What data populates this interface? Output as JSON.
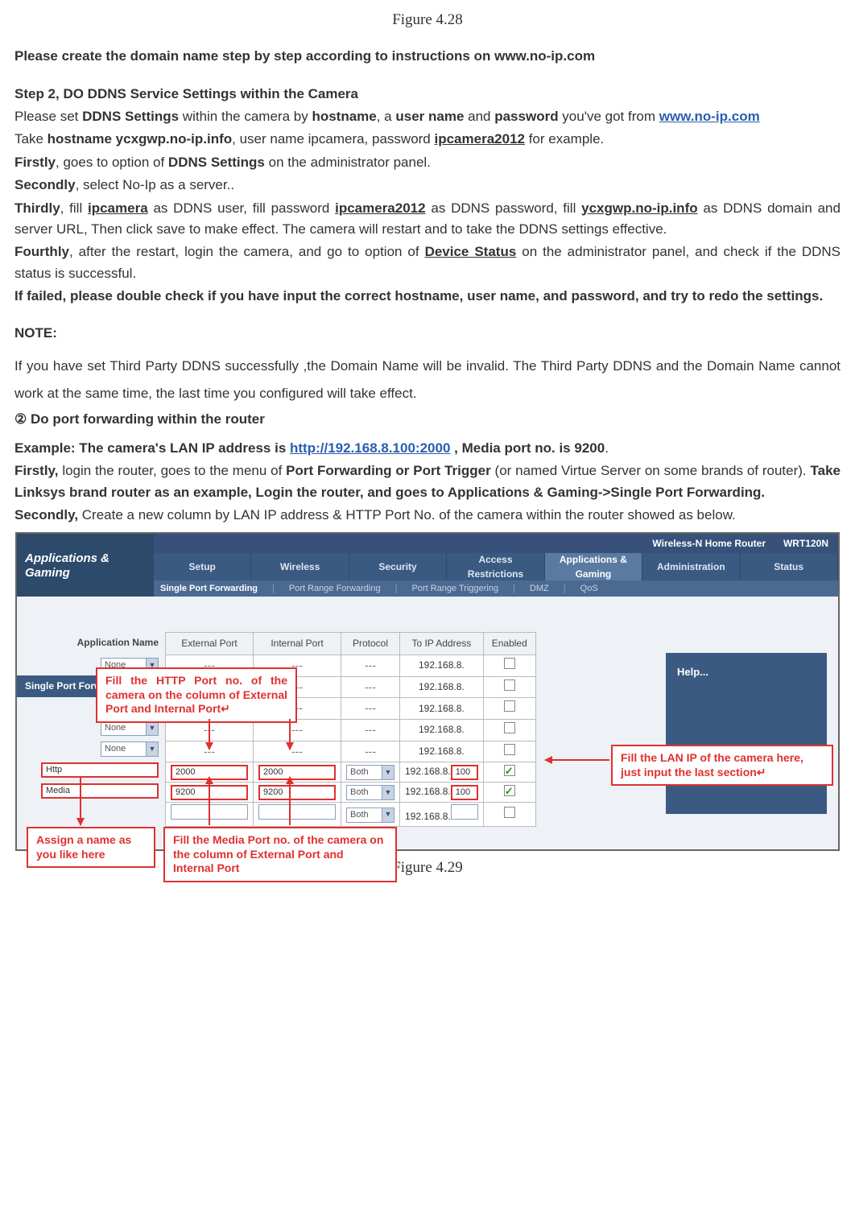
{
  "fig_top": "Figure 4.28",
  "fig_bottom": "Figure 4.29",
  "p1": "Please create the domain name step by step according to instructions on www.no-ip.com",
  "step2_title": "Step 2, DO DDNS Service Settings within the Camera",
  "p2a": "Please set ",
  "p2b": "DDNS Settings",
  "p2c": " within the camera by ",
  "p2d": "hostname",
  "p2e": ", a ",
  "p2f": "user name",
  "p2g": " and ",
  "p2h": "password",
  "p2i": " you've got from ",
  "noip_link": "www.no-ip.com",
  "p3a": "Take ",
  "p3b": "hostname ycxgwp.no-ip.info",
  "p3c": ", user name ipcamera, password ",
  "p3d": "ipcamera2012",
  "p3e": " for example.",
  "p4a": "Firstly",
  "p4b": ", goes to option of ",
  "p4c": "DDNS Settings",
  "p4d": " on the administrator panel.",
  "p5a": "Secondly",
  "p5b": ", select No-Ip as a server..",
  "p6a": "Thirdly",
  "p6b": ", fill ",
  "p6c": "ipcamera",
  "p6d": " as DDNS user, fill password ",
  "p6e": "ipcamera2012",
  "p6f": " as DDNS password, fill ",
  "p6g": "ycxgwp.no-ip.info",
  "p6h": " as DDNS domain and server URL, Then click save to make effect. The camera will restart and to take the DDNS settings effective.",
  "p7a": "Fourthly",
  "p7b": ", after the restart, login the camera, and go to option of ",
  "p7c": "Device Status",
  "p7d": " on the administrator panel, and check if the DDNS status is successful.",
  "p8": "If failed, please double check if you have input the correct hostname, user name, and password, and try to redo the settings.",
  "note": "NOTE:",
  "p9": "If you have set Third Party DDNS successfully ,the Domain Name will be invalid. The Third Party DDNS and the Domain Name cannot work at the same time, the last time you configured will take effect.",
  "p10": "② Do port forwarding within the router",
  "p11a": "Example: The camera's LAN IP address is ",
  "p11b": "http://192.168.8.100:2000",
  "p11c": " , Media port no. is 9200",
  "p11d": ".",
  "p12a": "Firstly,",
  "p12b": " login the router, goes to the menu of ",
  "p12c": "Port Forwarding or Port Trigger",
  "p12d": " (or named Virtue Server on some brands of router). ",
  "p12e": "Take Linksys brand router as an example, Login the router, and goes to Applications & Gaming->Single Port Forwarding.",
  "p13a": "Secondly,",
  "p13b": " Create a new column by LAN IP address & HTTP Port No. of the camera within the router showed as below.",
  "router": {
    "brand": "Wireless-N Home Router",
    "model": "WRT120N",
    "side_title": "Applications & Gaming",
    "nav": [
      "Setup",
      "Wireless",
      "Security",
      "Access Restrictions",
      "Applications & Gaming",
      "Administration",
      "Status"
    ],
    "subnav": [
      "Single Port Forwarding",
      "Port Range Forwarding",
      "Port Range Triggering",
      "DMZ",
      "QoS"
    ],
    "section": "Single Port Forwarding",
    "appname_hdr": "Application Name",
    "cols": [
      "External Port",
      "Internal Port",
      "Protocol",
      "To IP Address",
      "Enabled"
    ],
    "help": "Help...",
    "rows_dropdown": [
      {
        "app": "None",
        "ip": "192.168.8."
      },
      {
        "app": "None",
        "ip": "192.168.8."
      },
      {
        "app": "None",
        "ip": "192.168.8."
      },
      {
        "app": "None",
        "ip": "192.168.8."
      },
      {
        "app": "None",
        "ip": "192.168.8."
      }
    ],
    "rows_input": [
      {
        "app": "Http",
        "ext": "2000",
        "int": "2000",
        "proto": "Both",
        "ip": "192.168.8.",
        "ipend": "100",
        "enabled": true
      },
      {
        "app": "Media",
        "ext": "9200",
        "int": "9200",
        "proto": "Both",
        "ip": "192.168.8.",
        "ipend": "100",
        "enabled": true
      },
      {
        "app": "",
        "ext": "",
        "int": "",
        "proto": "Both",
        "ip": "192.168.8.",
        "ipend": "",
        "enabled": false
      }
    ]
  },
  "callouts": {
    "http": "Fill the HTTP Port no. of the camera on the column of External Port and Internal Port↵",
    "lan": "Fill the LAN IP of the camera here, just input the last section↵",
    "name": "Assign a name as you like here",
    "media": "Fill the Media Port no. of the camera on the column of External Port and Internal Port"
  }
}
